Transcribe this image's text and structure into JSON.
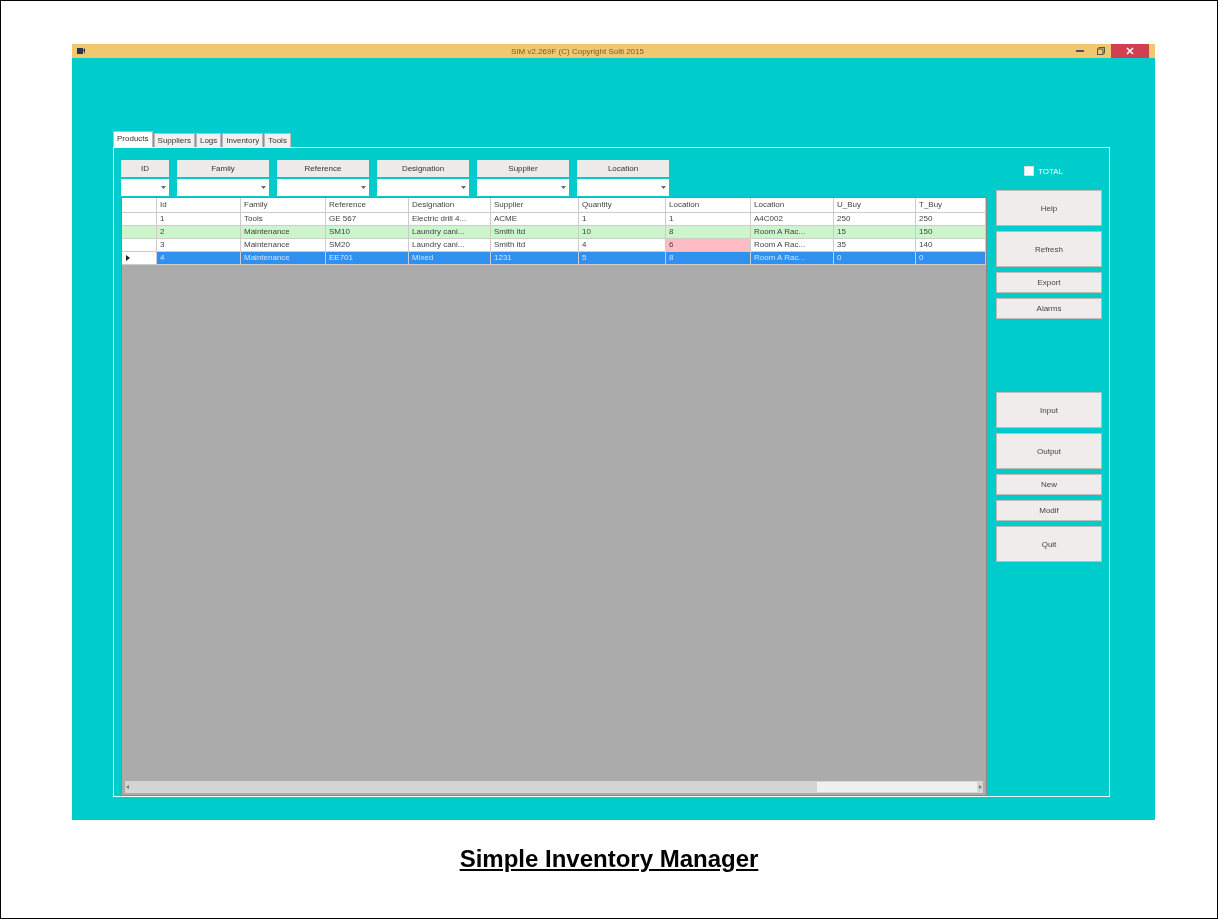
{
  "window": {
    "title": "SIM v2.269F (C) Copyright Solti 2015"
  },
  "tabs": [
    {
      "label": "Products",
      "selected": true
    },
    {
      "label": "Suppliers",
      "selected": false
    },
    {
      "label": "Logs",
      "selected": false
    },
    {
      "label": "Inventory",
      "selected": false
    },
    {
      "label": "Tools",
      "selected": false
    }
  ],
  "filters": [
    {
      "label": "ID"
    },
    {
      "label": "Family"
    },
    {
      "label": "Reference"
    },
    {
      "label": "Designation"
    },
    {
      "label": "Supplier"
    },
    {
      "label": "Location"
    }
  ],
  "total_checkbox": {
    "label": "TOTAL",
    "checked": false
  },
  "table": {
    "columns": [
      "Id",
      "Family",
      "Reference",
      "Designation",
      "Supplier",
      "Quantity",
      "Location",
      "Location",
      "U_Buy",
      "T_Buy"
    ],
    "rows": [
      {
        "selected": false,
        "color": "#ffffff",
        "location_alert": false,
        "cells": [
          "1",
          "Tools",
          "GE 567",
          "Electric drill 4...",
          "ACME",
          "1",
          "1",
          "A4C002",
          "250",
          "250"
        ]
      },
      {
        "selected": false,
        "color": "#ccf5cc",
        "location_alert": false,
        "cells": [
          "2",
          "Maintenance",
          "SM10",
          "Laundry cani...",
          "Smith ltd",
          "10",
          "8",
          "Room A Rac...",
          "15",
          "150"
        ]
      },
      {
        "selected": false,
        "color": "#ffffff",
        "location_alert": true,
        "cells": [
          "3",
          "Maintenance",
          "SM20",
          "Laundry cani...",
          "Smith ltd",
          "4",
          "6",
          "Room A Rac...",
          "35",
          "140"
        ]
      },
      {
        "selected": true,
        "color": "#ffffff",
        "location_alert": false,
        "cells": [
          "4",
          "Maintenance",
          "EE701",
          "Mixed",
          "1231",
          "5",
          "8",
          "Room A Rac...",
          "0",
          "0"
        ]
      }
    ]
  },
  "buttons": [
    {
      "label": "Help",
      "kind": "tall"
    },
    {
      "label": "Refresh",
      "kind": "tall"
    },
    {
      "label": "Export",
      "kind": "short"
    },
    {
      "label": "Alarms",
      "kind": "short"
    },
    {
      "label": "Input",
      "kind": "tall",
      "gap_before": true
    },
    {
      "label": "Output",
      "kind": "tall"
    },
    {
      "label": "New",
      "kind": "short"
    },
    {
      "label": "Modif",
      "kind": "short"
    },
    {
      "label": "Quit",
      "kind": "tall"
    }
  ],
  "caption": "Simple Inventory Manager"
}
